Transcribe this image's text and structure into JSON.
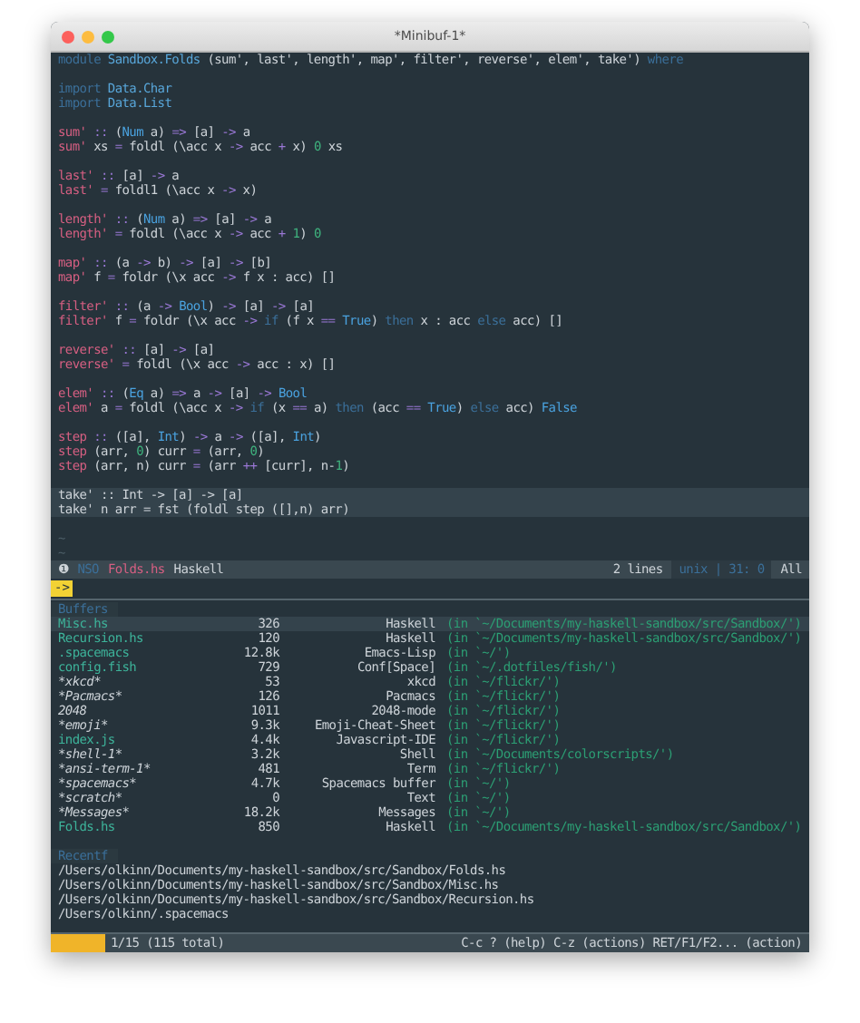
{
  "window": {
    "title": "*Minibuf-1*"
  },
  "editor": {
    "lines": [
      {
        "kind": "code",
        "highlighted": false,
        "tokens": [
          {
            "kind": "kw",
            "text": "module "
          },
          {
            "kind": "mod",
            "text": "Sandbox.Folds"
          },
          {
            "kind": "plain",
            "text": " (sum', last', length', map', filter', reverse', elem', take') "
          },
          {
            "kind": "kw",
            "text": "where"
          }
        ]
      },
      {
        "kind": "blank",
        "highlighted": false
      },
      {
        "kind": "code",
        "highlighted": false,
        "tokens": [
          {
            "kind": "kw",
            "text": "import "
          },
          {
            "kind": "mod",
            "text": "Data.Char"
          }
        ]
      },
      {
        "kind": "code",
        "highlighted": false,
        "tokens": [
          {
            "kind": "kw",
            "text": "import "
          },
          {
            "kind": "mod",
            "text": "Data.List"
          }
        ]
      },
      {
        "kind": "blank",
        "highlighted": false
      },
      {
        "kind": "code",
        "highlighted": false,
        "tokens": [
          {
            "kind": "fn",
            "text": "sum'"
          },
          {
            "kind": "op",
            "text": " :: "
          },
          {
            "kind": "plain",
            "text": "("
          },
          {
            "kind": "type",
            "text": "Num"
          },
          {
            "kind": "plain",
            "text": " a) "
          },
          {
            "kind": "op",
            "text": "=>"
          },
          {
            "kind": "plain",
            "text": " [a] "
          },
          {
            "kind": "op",
            "text": "->"
          },
          {
            "kind": "plain",
            "text": " a"
          }
        ]
      },
      {
        "kind": "code",
        "highlighted": false,
        "tokens": [
          {
            "kind": "fn",
            "text": "sum'"
          },
          {
            "kind": "plain",
            "text": " xs "
          },
          {
            "kind": "op",
            "text": "="
          },
          {
            "kind": "plain",
            "text": " foldl (\\acc x "
          },
          {
            "kind": "op",
            "text": "->"
          },
          {
            "kind": "plain",
            "text": " acc "
          },
          {
            "kind": "op",
            "text": "+"
          },
          {
            "kind": "plain",
            "text": " x) "
          },
          {
            "kind": "num",
            "text": "0"
          },
          {
            "kind": "plain",
            "text": " xs"
          }
        ]
      },
      {
        "kind": "blank",
        "highlighted": false
      },
      {
        "kind": "code",
        "highlighted": false,
        "tokens": [
          {
            "kind": "fn",
            "text": "last'"
          },
          {
            "kind": "op",
            "text": " :: "
          },
          {
            "kind": "plain",
            "text": "[a] "
          },
          {
            "kind": "op",
            "text": "->"
          },
          {
            "kind": "plain",
            "text": " a"
          }
        ]
      },
      {
        "kind": "code",
        "highlighted": false,
        "tokens": [
          {
            "kind": "fn",
            "text": "last'"
          },
          {
            "kind": "op",
            "text": " = "
          },
          {
            "kind": "plain",
            "text": "foldl1 (\\acc x "
          },
          {
            "kind": "op",
            "text": "->"
          },
          {
            "kind": "plain",
            "text": " x)"
          }
        ]
      },
      {
        "kind": "blank",
        "highlighted": false
      },
      {
        "kind": "code",
        "highlighted": false,
        "tokens": [
          {
            "kind": "fn",
            "text": "length'"
          },
          {
            "kind": "op",
            "text": " :: "
          },
          {
            "kind": "plain",
            "text": "("
          },
          {
            "kind": "type",
            "text": "Num"
          },
          {
            "kind": "plain",
            "text": " a) "
          },
          {
            "kind": "op",
            "text": "=>"
          },
          {
            "kind": "plain",
            "text": " [a] "
          },
          {
            "kind": "op",
            "text": "->"
          },
          {
            "kind": "plain",
            "text": " a"
          }
        ]
      },
      {
        "kind": "code",
        "highlighted": false,
        "tokens": [
          {
            "kind": "fn",
            "text": "length'"
          },
          {
            "kind": "op",
            "text": " = "
          },
          {
            "kind": "plain",
            "text": "foldl (\\acc x "
          },
          {
            "kind": "op",
            "text": "->"
          },
          {
            "kind": "plain",
            "text": " acc "
          },
          {
            "kind": "op",
            "text": "+ "
          },
          {
            "kind": "num",
            "text": "1"
          },
          {
            "kind": "plain",
            "text": ") "
          },
          {
            "kind": "num",
            "text": "0"
          }
        ]
      },
      {
        "kind": "blank",
        "highlighted": false
      },
      {
        "kind": "code",
        "highlighted": false,
        "tokens": [
          {
            "kind": "fn",
            "text": "map'"
          },
          {
            "kind": "op",
            "text": " :: "
          },
          {
            "kind": "plain",
            "text": "(a "
          },
          {
            "kind": "op",
            "text": "->"
          },
          {
            "kind": "plain",
            "text": " b) "
          },
          {
            "kind": "op",
            "text": "->"
          },
          {
            "kind": "plain",
            "text": " [a] "
          },
          {
            "kind": "op",
            "text": "->"
          },
          {
            "kind": "plain",
            "text": " [b]"
          }
        ]
      },
      {
        "kind": "code",
        "highlighted": false,
        "tokens": [
          {
            "kind": "fn",
            "text": "map'"
          },
          {
            "kind": "plain",
            "text": " f "
          },
          {
            "kind": "op",
            "text": "="
          },
          {
            "kind": "plain",
            "text": " foldr (\\x acc "
          },
          {
            "kind": "op",
            "text": "->"
          },
          {
            "kind": "plain",
            "text": " f x : acc) []"
          }
        ]
      },
      {
        "kind": "blank",
        "highlighted": false
      },
      {
        "kind": "code",
        "highlighted": false,
        "tokens": [
          {
            "kind": "fn",
            "text": "filter'"
          },
          {
            "kind": "op",
            "text": " :: "
          },
          {
            "kind": "plain",
            "text": "(a "
          },
          {
            "kind": "op",
            "text": "-> "
          },
          {
            "kind": "type",
            "text": "Bool"
          },
          {
            "kind": "plain",
            "text": ") "
          },
          {
            "kind": "op",
            "text": "->"
          },
          {
            "kind": "plain",
            "text": " [a] "
          },
          {
            "kind": "op",
            "text": "->"
          },
          {
            "kind": "plain",
            "text": " [a]"
          }
        ]
      },
      {
        "kind": "code",
        "highlighted": false,
        "tokens": [
          {
            "kind": "fn",
            "text": "filter'"
          },
          {
            "kind": "plain",
            "text": " f "
          },
          {
            "kind": "op",
            "text": "="
          },
          {
            "kind": "plain",
            "text": " foldr (\\x acc "
          },
          {
            "kind": "op",
            "text": "-> "
          },
          {
            "kind": "kw",
            "text": "if"
          },
          {
            "kind": "plain",
            "text": " (f x "
          },
          {
            "kind": "op",
            "text": "== "
          },
          {
            "kind": "type",
            "text": "True"
          },
          {
            "kind": "plain",
            "text": ") "
          },
          {
            "kind": "kw",
            "text": "then"
          },
          {
            "kind": "plain",
            "text": " x : acc "
          },
          {
            "kind": "kw",
            "text": "else"
          },
          {
            "kind": "plain",
            "text": " acc) []"
          }
        ]
      },
      {
        "kind": "blank",
        "highlighted": false
      },
      {
        "kind": "code",
        "highlighted": false,
        "tokens": [
          {
            "kind": "fn",
            "text": "reverse'"
          },
          {
            "kind": "op",
            "text": " :: "
          },
          {
            "kind": "plain",
            "text": "[a] "
          },
          {
            "kind": "op",
            "text": "->"
          },
          {
            "kind": "plain",
            "text": " [a]"
          }
        ]
      },
      {
        "kind": "code",
        "highlighted": false,
        "tokens": [
          {
            "kind": "fn",
            "text": "reverse'"
          },
          {
            "kind": "op",
            "text": " = "
          },
          {
            "kind": "plain",
            "text": "foldl (\\x acc "
          },
          {
            "kind": "op",
            "text": "->"
          },
          {
            "kind": "plain",
            "text": " acc : x) []"
          }
        ]
      },
      {
        "kind": "blank",
        "highlighted": false
      },
      {
        "kind": "code",
        "highlighted": false,
        "tokens": [
          {
            "kind": "fn",
            "text": "elem'"
          },
          {
            "kind": "op",
            "text": " :: "
          },
          {
            "kind": "plain",
            "text": "("
          },
          {
            "kind": "type",
            "text": "Eq"
          },
          {
            "kind": "plain",
            "text": " a) "
          },
          {
            "kind": "op",
            "text": "=>"
          },
          {
            "kind": "plain",
            "text": " a "
          },
          {
            "kind": "op",
            "text": "->"
          },
          {
            "kind": "plain",
            "text": " [a] "
          },
          {
            "kind": "op",
            "text": "-> "
          },
          {
            "kind": "type",
            "text": "Bool"
          }
        ]
      },
      {
        "kind": "code",
        "highlighted": false,
        "tokens": [
          {
            "kind": "fn",
            "text": "elem'"
          },
          {
            "kind": "plain",
            "text": " a "
          },
          {
            "kind": "op",
            "text": "="
          },
          {
            "kind": "plain",
            "text": " foldl (\\acc x "
          },
          {
            "kind": "op",
            "text": "-> "
          },
          {
            "kind": "kw",
            "text": "if"
          },
          {
            "kind": "plain",
            "text": " (x "
          },
          {
            "kind": "op",
            "text": "=="
          },
          {
            "kind": "plain",
            "text": " a) "
          },
          {
            "kind": "kw",
            "text": "then"
          },
          {
            "kind": "plain",
            "text": " (acc "
          },
          {
            "kind": "op",
            "text": "== "
          },
          {
            "kind": "type",
            "text": "True"
          },
          {
            "kind": "plain",
            "text": ") "
          },
          {
            "kind": "kw",
            "text": "else"
          },
          {
            "kind": "plain",
            "text": " acc) "
          },
          {
            "kind": "type",
            "text": "False"
          }
        ]
      },
      {
        "kind": "blank",
        "highlighted": false
      },
      {
        "kind": "code",
        "highlighted": false,
        "tokens": [
          {
            "kind": "fn",
            "text": "step"
          },
          {
            "kind": "op",
            "text": " :: "
          },
          {
            "kind": "plain",
            "text": "([a], "
          },
          {
            "kind": "type",
            "text": "Int"
          },
          {
            "kind": "plain",
            "text": ") "
          },
          {
            "kind": "op",
            "text": "->"
          },
          {
            "kind": "plain",
            "text": " a "
          },
          {
            "kind": "op",
            "text": "->"
          },
          {
            "kind": "plain",
            "text": " ([a], "
          },
          {
            "kind": "type",
            "text": "Int"
          },
          {
            "kind": "plain",
            "text": ")"
          }
        ]
      },
      {
        "kind": "code",
        "highlighted": false,
        "tokens": [
          {
            "kind": "fn",
            "text": "step"
          },
          {
            "kind": "plain",
            "text": " (arr, "
          },
          {
            "kind": "num",
            "text": "0"
          },
          {
            "kind": "plain",
            "text": ") curr "
          },
          {
            "kind": "op",
            "text": "="
          },
          {
            "kind": "plain",
            "text": " (arr, "
          },
          {
            "kind": "num",
            "text": "0"
          },
          {
            "kind": "plain",
            "text": ")"
          }
        ]
      },
      {
        "kind": "code",
        "highlighted": false,
        "tokens": [
          {
            "kind": "fn",
            "text": "step"
          },
          {
            "kind": "plain",
            "text": " (arr, n) curr "
          },
          {
            "kind": "op",
            "text": "="
          },
          {
            "kind": "plain",
            "text": " (arr "
          },
          {
            "kind": "op",
            "text": "++"
          },
          {
            "kind": "plain",
            "text": " [curr], n-"
          },
          {
            "kind": "num",
            "text": "1"
          },
          {
            "kind": "plain",
            "text": ")"
          }
        ]
      },
      {
        "kind": "blank",
        "highlighted": false
      },
      {
        "kind": "code",
        "highlighted": true,
        "tokens": [
          {
            "kind": "plain",
            "text": "take' :: Int -> [a] -> [a]"
          }
        ]
      },
      {
        "kind": "code",
        "highlighted": true,
        "tokens": [
          {
            "kind": "plain",
            "text": "take' n arr = fst (foldl step ([],n) arr)"
          }
        ]
      },
      {
        "kind": "blank",
        "highlighted": false
      },
      {
        "kind": "marker",
        "highlighted": false,
        "text": "~"
      },
      {
        "kind": "marker",
        "highlighted": false,
        "text": "~"
      }
    ]
  },
  "mode_line": {
    "window_number": "❶",
    "state": "NSO",
    "buffer": "Folds.hs",
    "mode": "Haskell",
    "selection": "2 lines",
    "position": "unix | 31: 0",
    "scroll": "All"
  },
  "minibuffer": {
    "prompt": "->"
  },
  "helm": {
    "sections": [
      {
        "title": "Buffers",
        "rows": [
          {
            "kind": "file",
            "selected": true,
            "name": "Misc.hs",
            "size": "326",
            "mode": "Haskell",
            "path": "(in `~/Documents/my-haskell-sandbox/src/Sandbox/')"
          },
          {
            "kind": "file",
            "selected": false,
            "name": "Recursion.hs",
            "size": "120",
            "mode": "Haskell",
            "path": "(in `~/Documents/my-haskell-sandbox/src/Sandbox/')"
          },
          {
            "kind": "file",
            "selected": false,
            "name": ".spacemacs",
            "size": "12.8k",
            "mode": "Emacs-Lisp",
            "path": "(in `~/')"
          },
          {
            "kind": "file",
            "selected": false,
            "name": "config.fish",
            "size": "729",
            "mode": "Conf[Space]",
            "path": "(in `~/.dotfiles/fish/')"
          },
          {
            "kind": "special",
            "selected": false,
            "name": "*xkcd*",
            "size": "53",
            "mode": "xkcd",
            "path": "(in `~/flickr/')"
          },
          {
            "kind": "special",
            "selected": false,
            "name": "*Pacmacs*",
            "size": "126",
            "mode": "Pacmacs",
            "path": "(in `~/flickr/')"
          },
          {
            "kind": "special",
            "selected": false,
            "name": "2048",
            "size": "1011",
            "mode": "2048-mode",
            "path": "(in `~/flickr/')"
          },
          {
            "kind": "special",
            "selected": false,
            "name": "*emoji*",
            "size": "9.3k",
            "mode": "Emoji-Cheat-Sheet",
            "path": "(in `~/flickr/')"
          },
          {
            "kind": "file",
            "selected": false,
            "name": "index.js",
            "size": "4.4k",
            "mode": "Javascript-IDE",
            "path": "(in `~/flickr/')"
          },
          {
            "kind": "special",
            "selected": false,
            "name": "*shell-1*",
            "size": "3.2k",
            "mode": "Shell",
            "path": "(in `~/Documents/colorscripts/')"
          },
          {
            "kind": "special",
            "selected": false,
            "name": "*ansi-term-1*",
            "size": "481",
            "mode": "Term",
            "path": "(in `~/flickr/')"
          },
          {
            "kind": "special",
            "selected": false,
            "name": "*spacemacs*",
            "size": "4.7k",
            "mode": "Spacemacs buffer",
            "path": "(in `~/')"
          },
          {
            "kind": "special",
            "selected": false,
            "name": "*scratch*",
            "size": "0",
            "mode": "Text",
            "path": "(in `~/')"
          },
          {
            "kind": "special",
            "selected": false,
            "name": "*Messages*",
            "size": "18.2k",
            "mode": "Messages",
            "path": "(in `~/')"
          },
          {
            "kind": "file",
            "selected": false,
            "name": "Folds.hs",
            "size": "850",
            "mode": "Haskell",
            "path": "(in `~/Documents/my-haskell-sandbox/src/Sandbox/')"
          }
        ]
      },
      {
        "title": "Recentf",
        "rows": [
          {
            "kind": "recent",
            "selected": false,
            "path": "/Users/olkinn/Documents/my-haskell-sandbox/src/Sandbox/Folds.hs"
          },
          {
            "kind": "recent",
            "selected": false,
            "path": "/Users/olkinn/Documents/my-haskell-sandbox/src/Sandbox/Misc.hs"
          },
          {
            "kind": "recent",
            "selected": false,
            "path": "/Users/olkinn/Documents/my-haskell-sandbox/src/Sandbox/Recursion.hs"
          },
          {
            "kind": "recent",
            "selected": false,
            "path": "/Users/olkinn/.spacemacs"
          }
        ]
      }
    ]
  },
  "helm_mode_line": {
    "count": "1/15 (115 total)",
    "keys": "C-c ? (help) C-z (actions) RET/F1/F2... (action)"
  }
}
